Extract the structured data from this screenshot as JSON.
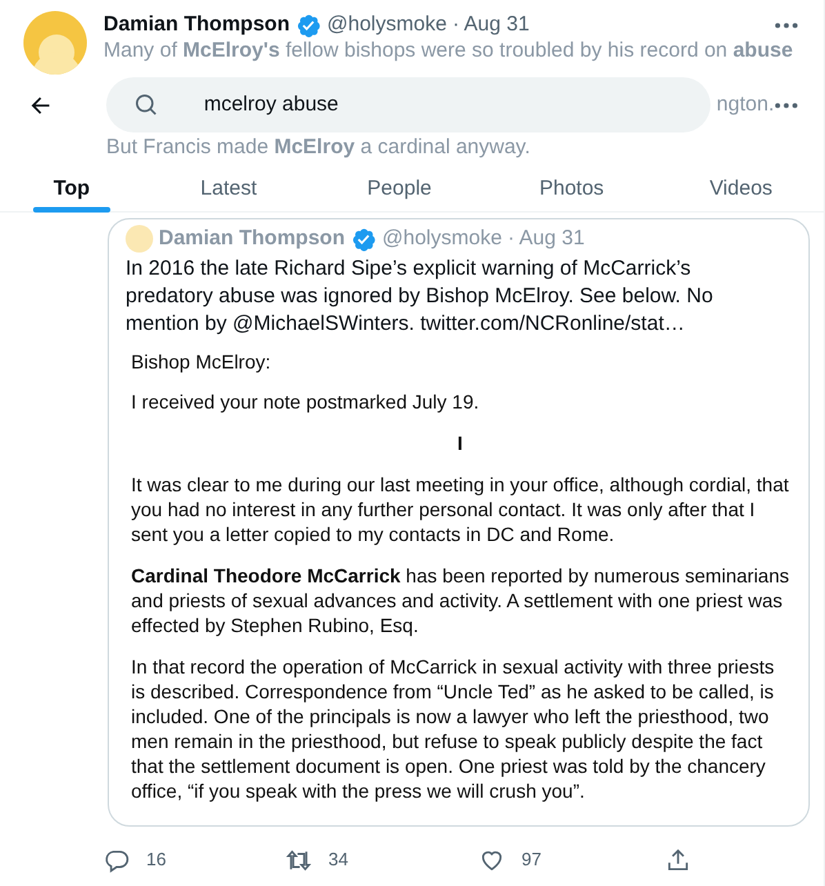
{
  "tweet": {
    "author": "Damian Thompson",
    "handle": "@holysmoke",
    "date": "· Aug 31",
    "faded_lines": [
      "Many of **McElroy's** fellow bishops were so troubled by his record on **abuse**",
      "ngton.",
      "But Francis made **McElroy** a cardinal anyway."
    ],
    "quote": {
      "author": "Damian Thompson",
      "handle": "@holysmoke",
      "date": "· Aug 31",
      "text": "In 2016 the late Richard Sipe’s explicit warning of McCarrick’s predatory abuse was ignored by Bishop McElroy. See below. No mention by @MichaelSWinters.  twitter.com/NCRonline/stat…",
      "letter": [
        {
          "kind": "para",
          "text": "Bishop McElroy:"
        },
        {
          "kind": "para",
          "text": "I received your note postmarked July 19."
        },
        {
          "kind": "heading",
          "text": "I"
        },
        {
          "kind": "para",
          "text": "It was clear to me during our last meeting in your office, although cordial, that you had no interest in any further personal contact. It was only after that I sent you a letter copied to my contacts in DC and Rome."
        },
        {
          "kind": "para",
          "text": "**Cardinal Theodore McCarrick** has been reported by numerous seminarians and priests of sexual advances and activity. A settlement with one priest was effected by Stephen Rubino, Esq."
        },
        {
          "kind": "para",
          "text": "In that record the operation of McCarrick in sexual activity with three priests is described. Correspondence from “Uncle Ted” as he asked to be called, is included. One of the principals is now a lawyer who left the priesthood, two men remain in the priesthood, but refuse to speak publicly despite the fact that the settlement document is open. One priest was told by the chancery office, “if you speak with the press we will crush you”."
        }
      ]
    },
    "actions": [
      {
        "kind": "reply",
        "count": "16"
      },
      {
        "kind": "retweet",
        "count": "34"
      },
      {
        "kind": "like",
        "count": "97"
      },
      {
        "kind": "share"
      }
    ]
  },
  "search": {
    "value": "mcelroy abuse"
  },
  "tabs": [
    {
      "label": "Top",
      "selected": true
    },
    {
      "label": "Latest",
      "selected": false
    },
    {
      "label": "People",
      "selected": false
    },
    {
      "label": "Photos",
      "selected": false
    },
    {
      "label": "Videos",
      "selected": false
    }
  ]
}
